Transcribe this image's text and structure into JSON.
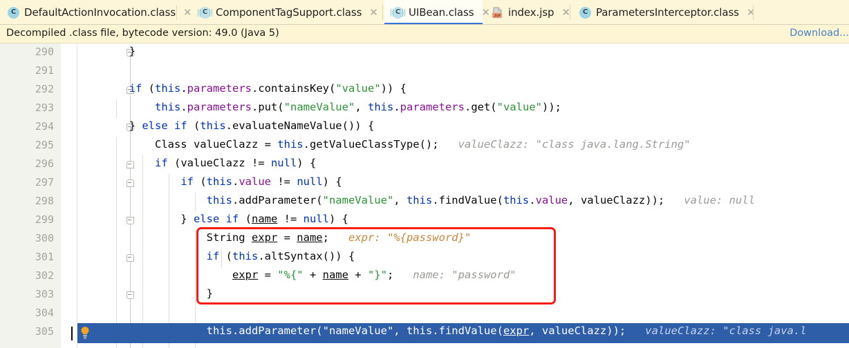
{
  "window": {
    "app": "IntelliJ IDEA Editor",
    "accent_color": "#3574d6",
    "notification_bg": "#fdf5d4",
    "selection_color": "#2f5ea8",
    "annotation_color": "#f61b13"
  },
  "tabs": [
    {
      "label": "DefaultActionInvocation.class",
      "icon": "java-class-icon",
      "close": "✕",
      "active": false
    },
    {
      "label": "ComponentTagSupport.class",
      "icon": "java-class-decompiled-icon",
      "close": "✕",
      "active": false
    },
    {
      "label": "UIBean.class",
      "icon": "java-class-decompiled-icon",
      "close": "✕",
      "active": true
    },
    {
      "label": "index.jsp",
      "icon": "jsp-file-icon",
      "close": "✕",
      "active": false
    },
    {
      "label": "ParametersInterceptor.class",
      "icon": "java-class-icon",
      "close": "✕",
      "active": false
    }
  ],
  "notification": {
    "message": "Decompiled .class file, bytecode version: 49.0 (Java 5)",
    "action_label": "Download..."
  },
  "editor": {
    "first_line": 290,
    "last_line": 305,
    "selected_line": 305,
    "line_numbers": [
      "290",
      "291",
      "292",
      "293",
      "294",
      "295",
      "296",
      "297",
      "298",
      "299",
      "300",
      "301",
      "302",
      "303",
      "304",
      "305"
    ],
    "gutter_icon": "intention-bulb-icon",
    "lines": [
      {
        "n": "290",
        "text": "        }"
      },
      {
        "n": "291",
        "text": ""
      },
      {
        "n": "292",
        "text": "        if (this.parameters.containsKey(\"value\")) {"
      },
      {
        "n": "293",
        "text": "            this.parameters.put(\"nameValue\", this.parameters.get(\"value\"));"
      },
      {
        "n": "294",
        "text": "        } else if (this.evaluateNameValue()) {"
      },
      {
        "n": "295",
        "text": "            Class valueClazz = this.getValueClassType();",
        "hint": "valueClazz: \"class java.lang.String\""
      },
      {
        "n": "296",
        "text": "            if (valueClazz != null) {"
      },
      {
        "n": "297",
        "text": "                if (this.value != null) {"
      },
      {
        "n": "298",
        "text": "                    this.addParameter(\"nameValue\", this.findValue(this.value, valueClazz));",
        "hint": "value: null"
      },
      {
        "n": "299",
        "text": "                } else if (name != null) {"
      },
      {
        "n": "300",
        "text": "                    String expr = name;",
        "hint": "expr: \"%{password}\""
      },
      {
        "n": "301",
        "text": "                    if (this.altSyntax()) {"
      },
      {
        "n": "302",
        "text": "                        expr = \"%{\" + name + \"}\";",
        "hint": "name: \"password\""
      },
      {
        "n": "303",
        "text": "                    }"
      },
      {
        "n": "304",
        "text": ""
      },
      {
        "n": "305",
        "text": "                    this.addParameter(\"nameValue\", this.findValue(expr, valueClazz));",
        "hint": "valueClazz: \"class java.l"
      }
    ]
  },
  "annotation": {
    "shape": "rectangle",
    "color": "#f61b13",
    "covers_lines": "300-303"
  }
}
